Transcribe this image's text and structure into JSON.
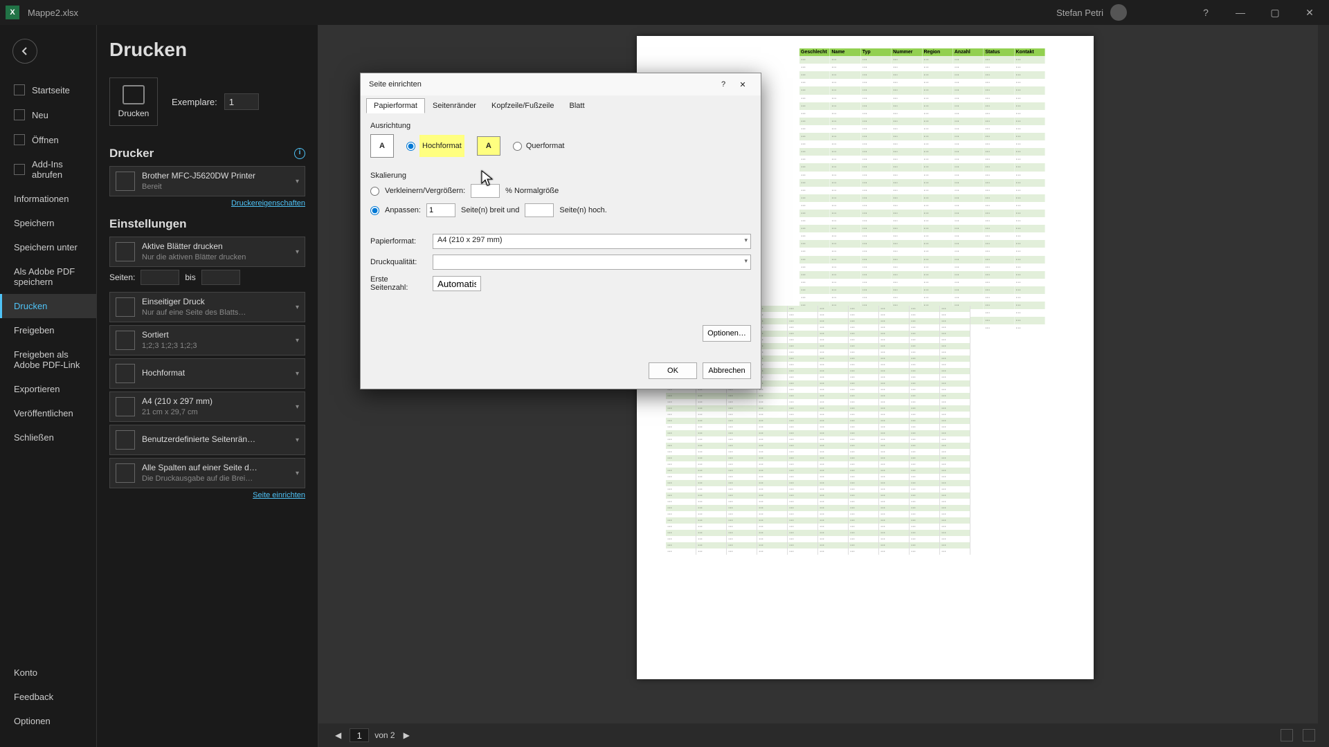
{
  "titlebar": {
    "filename": "Mappe2.xlsx",
    "username": "Stefan Petri"
  },
  "backstage": {
    "items": [
      {
        "label": "Startseite"
      },
      {
        "label": "Neu"
      },
      {
        "label": "Öffnen"
      },
      {
        "label": "Add-Ins abrufen"
      },
      {
        "label": "Informationen"
      },
      {
        "label": "Speichern"
      },
      {
        "label": "Speichern unter"
      },
      {
        "label": "Als Adobe PDF speichern"
      },
      {
        "label": "Drucken"
      },
      {
        "label": "Freigeben"
      },
      {
        "label": "Freigeben als Adobe PDF-Link"
      },
      {
        "label": "Exportieren"
      },
      {
        "label": "Veröffentlichen"
      },
      {
        "label": "Schließen"
      }
    ],
    "bottom": [
      {
        "label": "Konto"
      },
      {
        "label": "Feedback"
      },
      {
        "label": "Optionen"
      }
    ]
  },
  "print": {
    "heading": "Drucken",
    "print_button": "Drucken",
    "copies_label": "Exemplare:",
    "copies_value": "1",
    "printer_heading": "Drucker",
    "printer_name": "Brother MFC-J5620DW Printer",
    "printer_status": "Bereit",
    "printer_props": "Druckereigenschaften",
    "settings_heading": "Einstellungen",
    "active_sheets": "Aktive Blätter drucken",
    "active_sheets_sub": "Nur die aktiven Blätter drucken",
    "pages_label": "Seiten:",
    "pages_to": "bis",
    "onesided": "Einseitiger Druck",
    "onesided_sub": "Nur auf eine Seite des Blatts…",
    "sorted": "Sortiert",
    "sorted_sub": "1;2;3   1;2;3   1;2;3",
    "portrait": "Hochformat",
    "a4": "A4 (210 x 297 mm)",
    "a4_sub": "21 cm x 29,7 cm",
    "margins": "Benutzerdefinierte Seitenrän…",
    "fit": "Alle Spalten auf einer Seite d…",
    "fit_sub": "Die Druckausgabe auf die Brei…",
    "page_setup_link": "Seite einrichten"
  },
  "dialog": {
    "title": "Seite einrichten",
    "tabs": [
      "Papierformat",
      "Seitenränder",
      "Kopfzeile/Fußzeile",
      "Blatt"
    ],
    "orientation_label": "Ausrichtung",
    "portrait": "Hochformat",
    "landscape": "Querformat",
    "scaling_label": "Skalierung",
    "adjust": "Verkleinern/Vergrößern:",
    "adjust_suffix": "% Normalgröße",
    "fit": "Anpassen:",
    "fit_wide": "1",
    "fit_wide_label": "Seite(n) breit und",
    "fit_tall_label": "Seite(n) hoch.",
    "paper_label": "Papierformat:",
    "paper_value": "A4 (210 x 297 mm)",
    "quality_label": "Druckqualität:",
    "firstpage_label": "Erste Seitenzahl:",
    "firstpage_value": "Automatisch",
    "options": "Optionen…",
    "ok": "OK",
    "cancel": "Abbrechen"
  },
  "preview": {
    "page_current": "1",
    "page_total": "von 2",
    "sheet_headers": [
      "Geschlecht",
      "Name",
      "Typ",
      "Nummer",
      "Region",
      "Anzahl",
      "Status",
      "Kontakt"
    ]
  }
}
